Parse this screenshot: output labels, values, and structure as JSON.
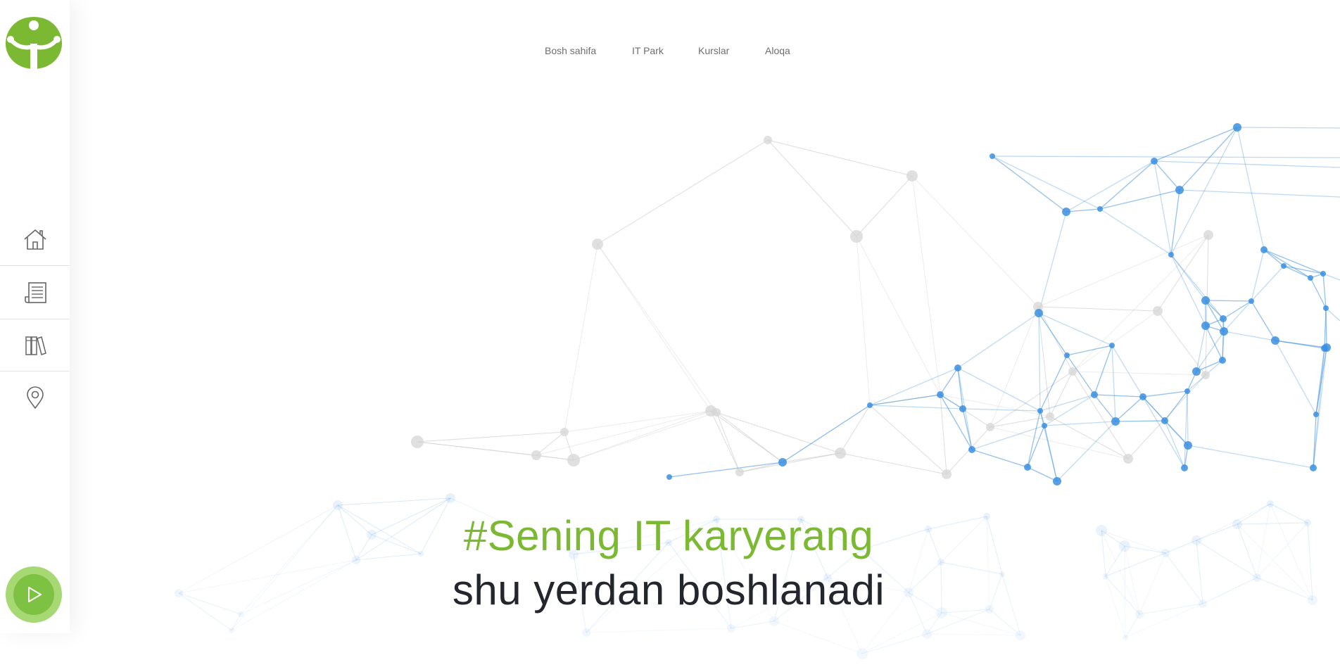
{
  "nav": {
    "links": [
      {
        "label": "Bosh sahifa"
      },
      {
        "label": "IT Park"
      },
      {
        "label": "Kurslar"
      },
      {
        "label": "Aloqa"
      }
    ]
  },
  "sidebar": {
    "items": [
      {
        "icon": "home-icon"
      },
      {
        "icon": "newspaper-icon"
      },
      {
        "icon": "books-icon"
      },
      {
        "icon": "location-pin-icon"
      }
    ],
    "play_icon": "play-icon"
  },
  "hero": {
    "line1": "#Sening IT karyerang",
    "line2": "shu yerdan boshlanadi"
  },
  "colors": {
    "brand_green": "#7cb932",
    "heading_dark": "#24262e",
    "network_blue": "#3b8fe0",
    "network_gray": "#d6d6d6"
  }
}
